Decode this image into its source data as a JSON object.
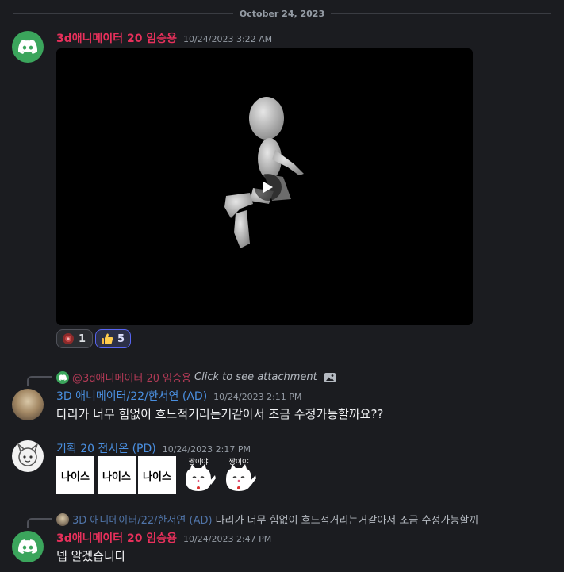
{
  "date_divider": "October 24, 2023",
  "messages": [
    {
      "author": "3d애니메이터 20 임승용",
      "timestamp": "10/24/2023 3:22 AM",
      "attachment": "video",
      "reactions": [
        {
          "emoji_icon": "red-badge-icon",
          "count": "1"
        },
        {
          "emoji_icon": "thumbs-up-icon",
          "count": "5"
        }
      ]
    },
    {
      "reply_to": {
        "mention": "@3d애니메이터 20 임승용",
        "text": "Click to see attachment"
      },
      "author": "3D 애니메이터/22/한서연 (AD)",
      "timestamp": "10/24/2023 2:11 PM",
      "text": "다리가 너무 힘없이 흐느적거리는거같아서 조금 수정가능할까요??"
    },
    {
      "author": "기획 20 전시온 (PD)",
      "timestamp": "10/24/2023 2:17 PM",
      "stickers": [
        "나이스",
        "나이스",
        "나이스"
      ],
      "cat_stickers": [
        "짱이야",
        "짱이야"
      ]
    },
    {
      "reply_to": {
        "mention": "3D 애니메이터/22/한서연 (AD)",
        "text": "다리가 너무 힘없이 흐느적거리는거같아서 조금 수정가능할끼"
      },
      "author": "3d애니메이터 20 임승용",
      "timestamp": "10/24/2023 2:47 PM",
      "text": "넵 알겠습니다"
    }
  ],
  "colors": {
    "background": "#1b1c20",
    "role_red": "#e8305b",
    "role_blue": "#4a8fe0",
    "discord_green": "#3ba55c"
  }
}
